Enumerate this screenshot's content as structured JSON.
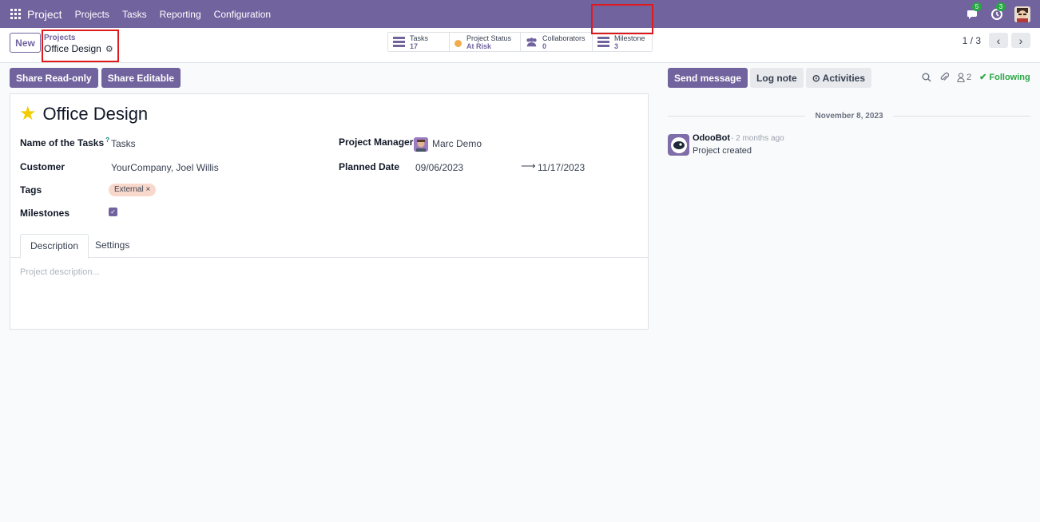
{
  "navbar": {
    "brand": "Project",
    "menu": [
      "Projects",
      "Tasks",
      "Reporting",
      "Configuration"
    ],
    "messages_count": "5",
    "activities_count": "3"
  },
  "control_panel": {
    "new_label": "New",
    "breadcrumb_parent": "Projects",
    "breadcrumb_current": "Office Design",
    "smart_buttons": [
      {
        "label": "Tasks",
        "value": "17"
      },
      {
        "label": "Project Status",
        "value": "At Risk"
      },
      {
        "label": "Collaborators",
        "value": "0"
      },
      {
        "label": "Milestone",
        "value": "3"
      }
    ],
    "pager": "1 / 3"
  },
  "share": {
    "read_only": "Share Read-only",
    "editable": "Share Editable"
  },
  "form": {
    "title": "Office Design",
    "fields": {
      "name_of_tasks_label": "Name of the Tasks",
      "name_of_tasks_tooltip": "?",
      "name_of_tasks_value": "Tasks",
      "customer_label": "Customer",
      "customer_value": "YourCompany, Joel Willis",
      "tags_label": "Tags",
      "tag_value": "External",
      "milestones_label": "Milestones",
      "project_manager_label": "Project Manager",
      "project_manager_value": "Marc Demo",
      "planned_date_label": "Planned Date",
      "planned_start": "09/06/2023",
      "planned_end": "11/17/2023"
    },
    "tabs": [
      "Description",
      "Settings"
    ],
    "description_placeholder": "Project description..."
  },
  "chatter": {
    "send_message": "Send message",
    "log_note": "Log note",
    "activities": "Activities",
    "followers_count": "2",
    "following": "Following",
    "date_separator": "November 8, 2023",
    "message": {
      "author": "OdooBot",
      "time": "- 2 months ago",
      "body": "Project created"
    }
  },
  "colors": {
    "brand": "#71639e",
    "highlight": "#e0191d",
    "success": "#28a745"
  }
}
